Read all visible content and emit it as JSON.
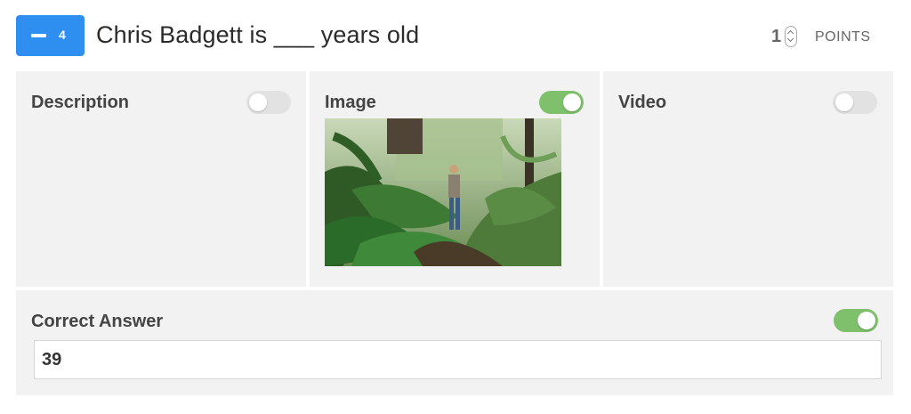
{
  "question": {
    "number": "4",
    "title": "Chris Badgett is ___ years old",
    "points_value": "1",
    "points_label": "POINTS"
  },
  "panels": {
    "description": {
      "title": "Description",
      "enabled": false
    },
    "image": {
      "title": "Image",
      "enabled": true
    },
    "video": {
      "title": "Video",
      "enabled": false
    }
  },
  "answer": {
    "title": "Correct Answer",
    "enabled": true,
    "value": "39"
  },
  "colors": {
    "accent": "#2f8ff0",
    "toggle_on": "#7ec06b",
    "toggle_off": "#e2e2e2",
    "panel_bg": "#f2f2f2"
  },
  "icons": [
    "minus-icon",
    "stepper-icon"
  ]
}
